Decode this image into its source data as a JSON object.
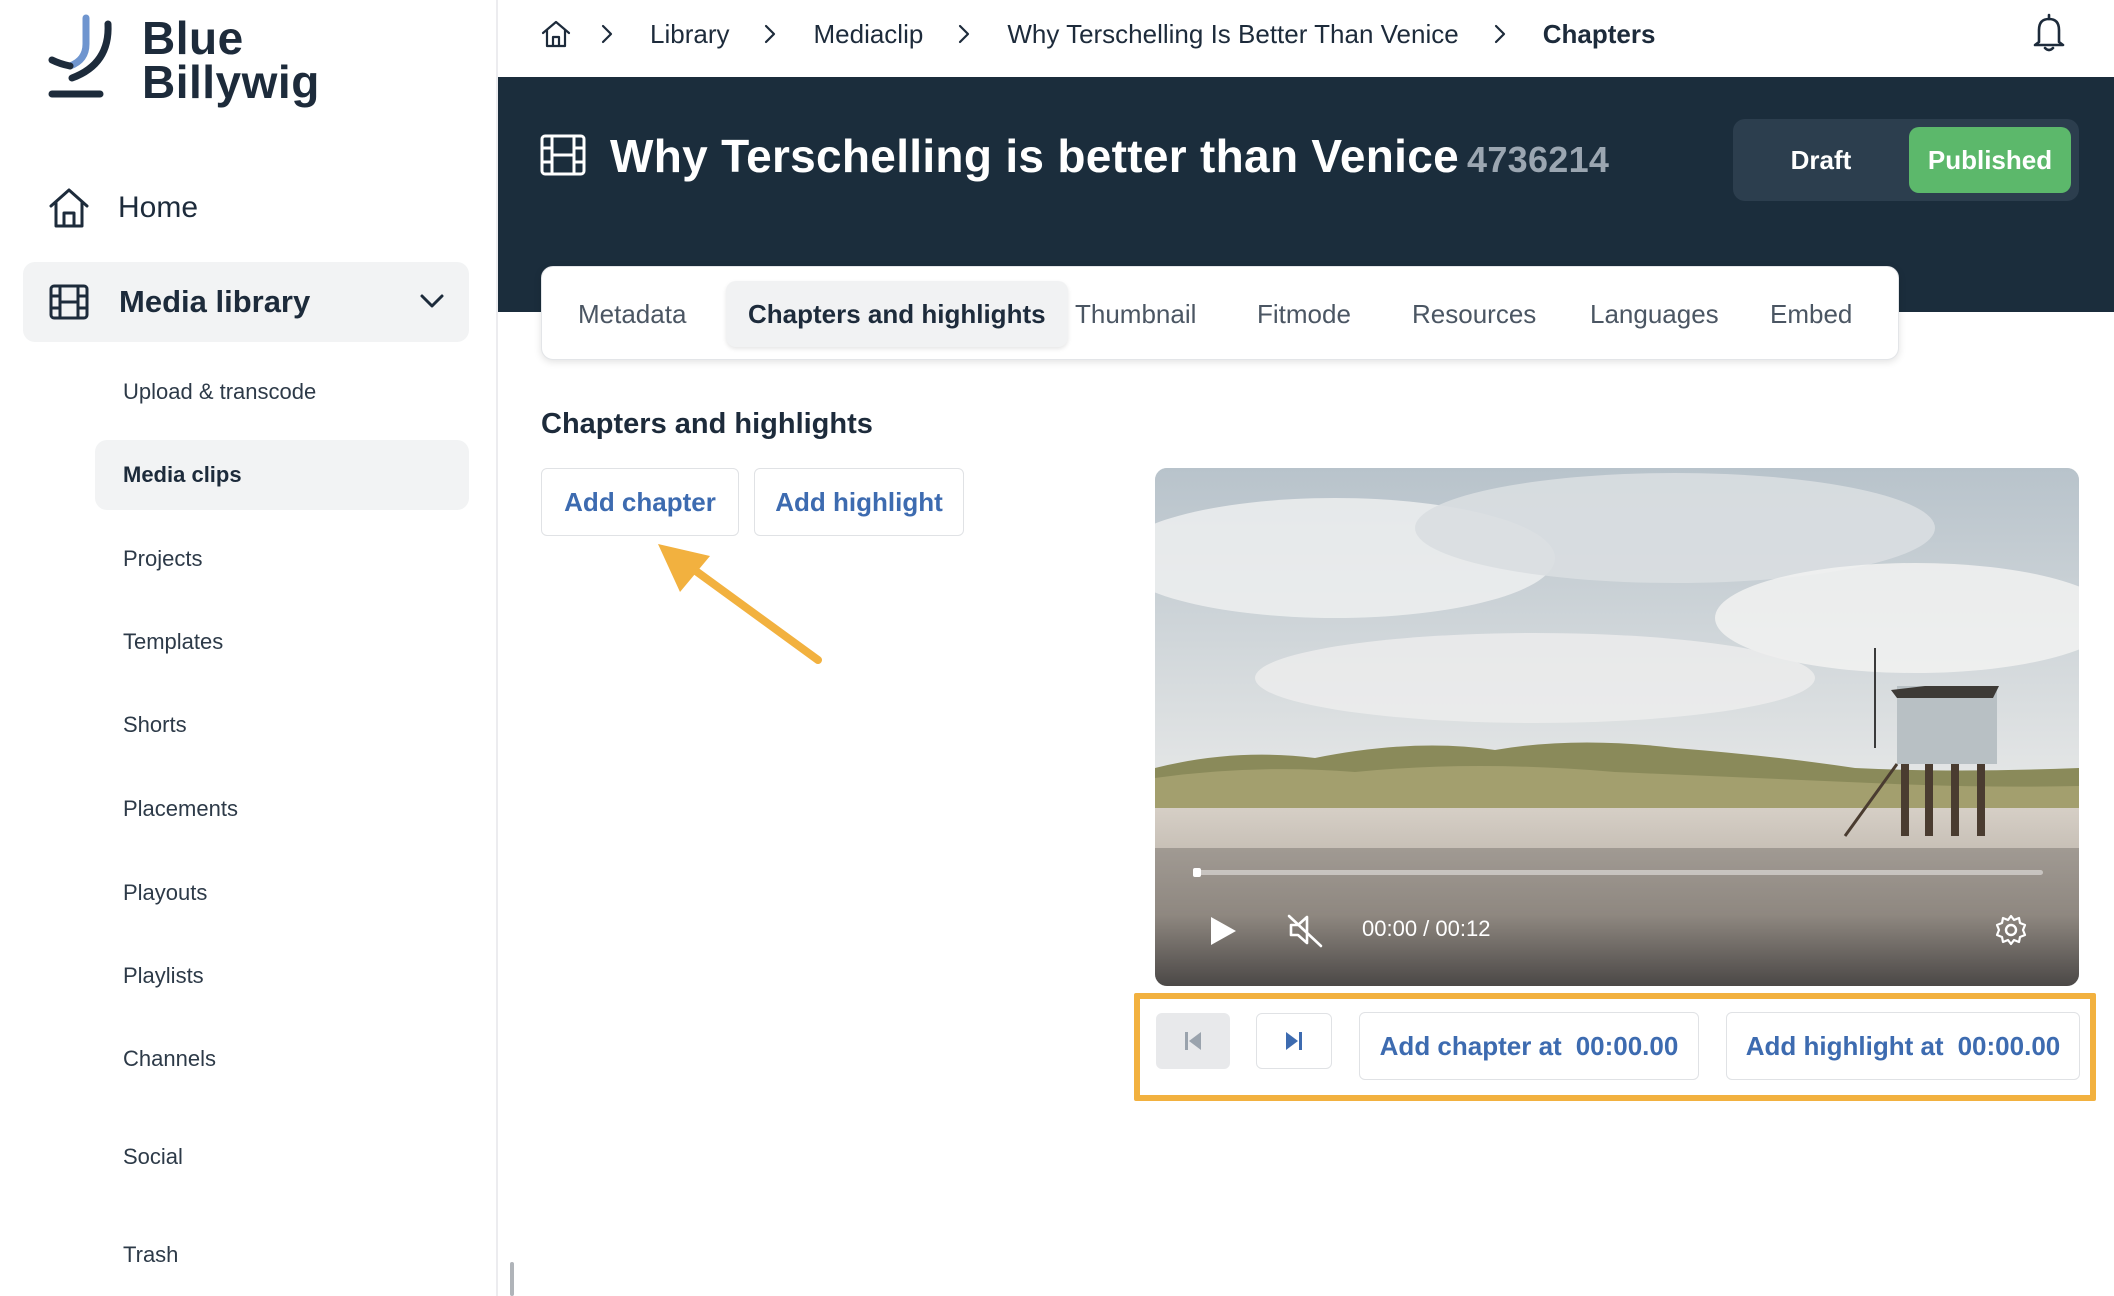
{
  "brand": {
    "line1": "Blue",
    "line2": "Billywig"
  },
  "sidebar": {
    "home": "Home",
    "media_library": "Media library",
    "items": [
      {
        "label": "Upload & transcode",
        "active": false
      },
      {
        "label": "Media clips",
        "active": true
      },
      {
        "label": "Projects",
        "active": false
      },
      {
        "label": "Templates",
        "active": false
      },
      {
        "label": "Shorts",
        "active": false
      },
      {
        "label": "Placements",
        "active": false
      },
      {
        "label": "Playouts",
        "active": false
      },
      {
        "label": "Playlists",
        "active": false
      },
      {
        "label": "Channels",
        "active": false
      },
      {
        "label": "Social",
        "active": false
      },
      {
        "label": "Trash",
        "active": false
      }
    ]
  },
  "breadcrumb": [
    "Library",
    "Mediaclip",
    "Why Terschelling Is Better Than Venice",
    "Chapters"
  ],
  "header": {
    "title": "Why Terschelling is better than Venice",
    "clip_id": "4736214",
    "status_draft": "Draft",
    "status_published": "Published"
  },
  "tabs": [
    "Metadata",
    "Chapters and highlights",
    "Thumbnail",
    "Fitmode",
    "Resources",
    "Languages",
    "Embed"
  ],
  "active_tab": "Chapters and highlights",
  "section": {
    "title": "Chapters and highlights",
    "add_chapter": "Add chapter",
    "add_highlight": "Add highlight"
  },
  "player": {
    "time": "00:00 / 00:12",
    "progress": 0
  },
  "controls": {
    "add_chapter_at": "Add chapter at",
    "add_chapter_time": "00:00.00",
    "add_highlight_at": "Add highlight at",
    "add_highlight_time": "00:00.00"
  },
  "colors": {
    "header_bg": "#1b2d3c",
    "published_green": "#5cb86b",
    "link_blue": "#3d6bb0",
    "annotation_orange": "#f2b13f"
  },
  "icons": [
    "house-icon",
    "film-icon",
    "chevron-down-icon",
    "chevron-right-icon",
    "bell-icon",
    "play-icon",
    "mute-icon",
    "settings-gear-icon",
    "skip-previous-icon",
    "skip-next-icon",
    "annotation-arrow"
  ]
}
